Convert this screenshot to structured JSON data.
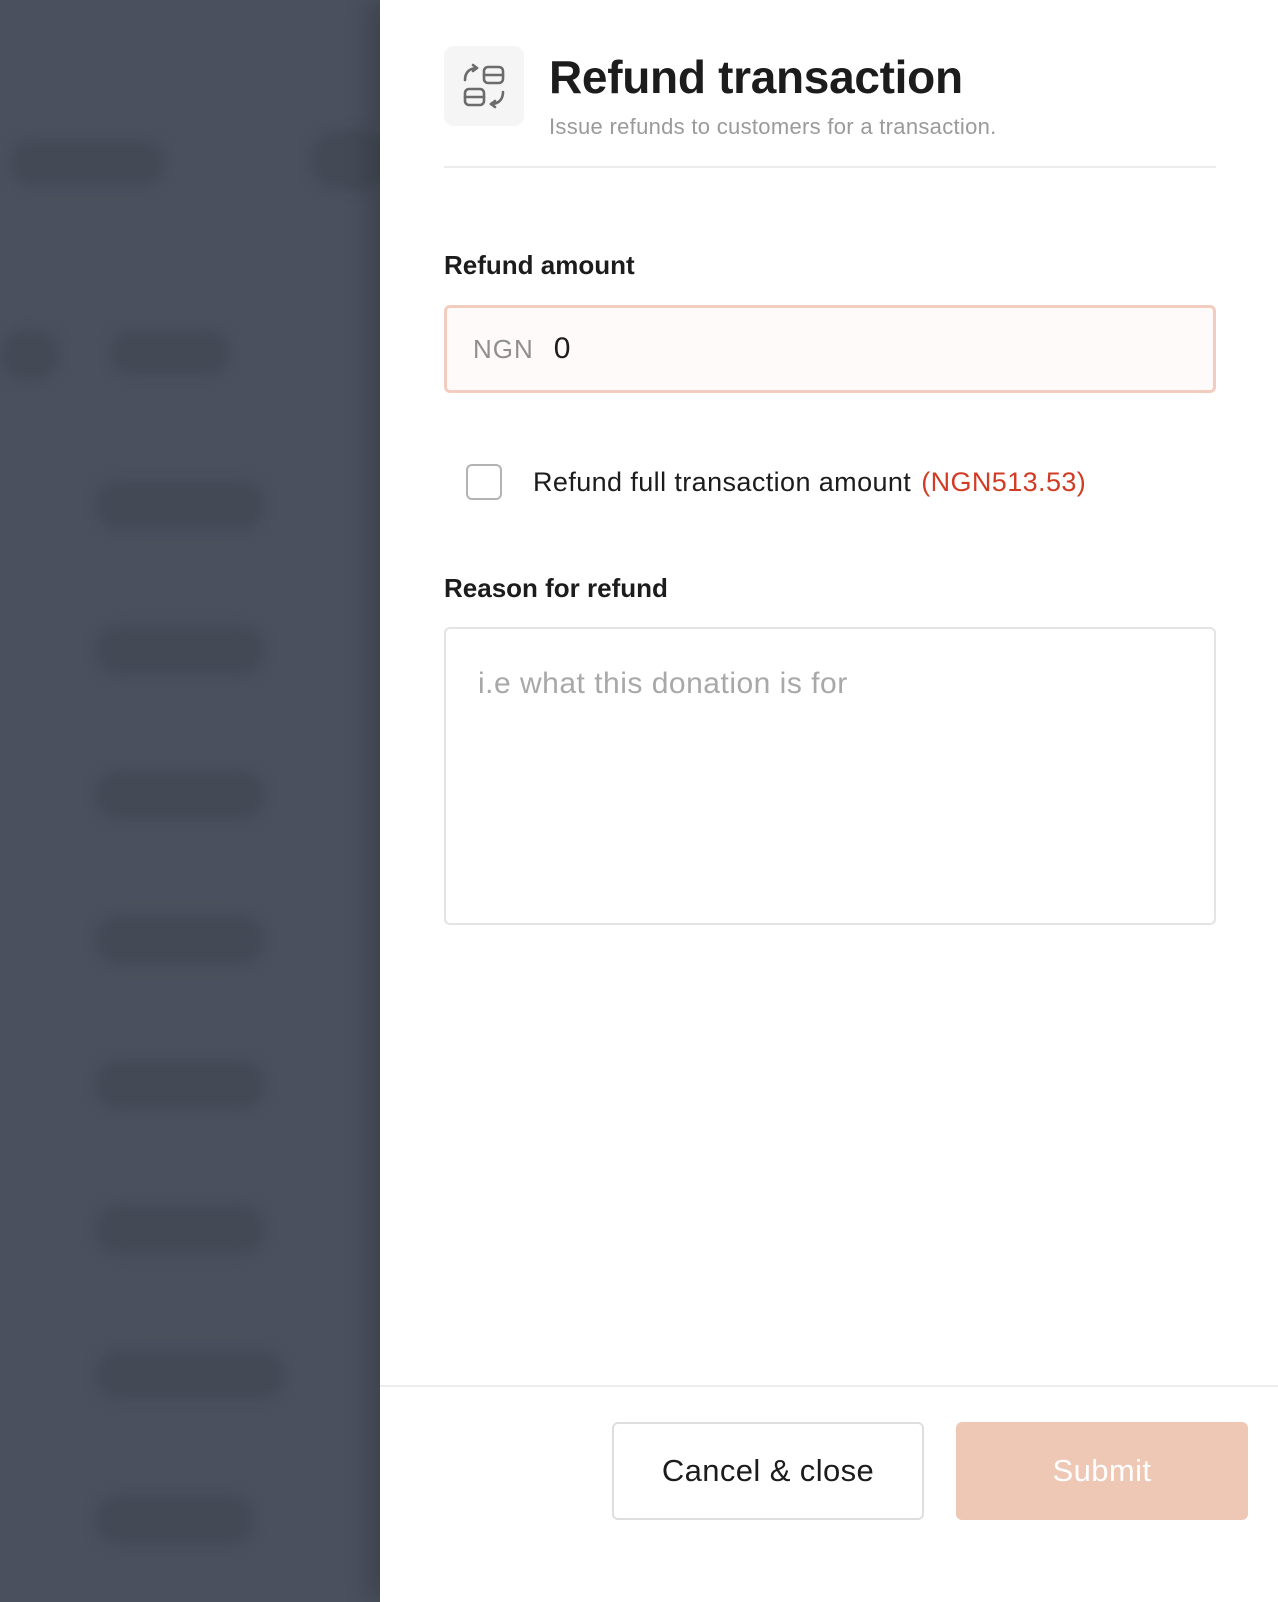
{
  "drawer": {
    "title": "Refund transaction",
    "subtitle": "Issue refunds to customers for a transaction.",
    "icon": "refund-exchange-icon"
  },
  "form": {
    "amount_label": "Refund amount",
    "currency": "NGN",
    "amount_value": "0",
    "full_refund_label": "Refund full transaction amount",
    "full_refund_amount": "(NGN513.53)",
    "full_refund_checked": false,
    "reason_label": "Reason for refund",
    "reason_placeholder": "i.e what this donation is for",
    "reason_value": ""
  },
  "footer": {
    "cancel_label": "Cancel & close",
    "submit_label": "Submit"
  },
  "colors": {
    "overlay": "#4a505d",
    "accent_red": "#d23c25",
    "submit_disabled": "#efc7b5",
    "input_border_focus": "#f2cdbf"
  }
}
